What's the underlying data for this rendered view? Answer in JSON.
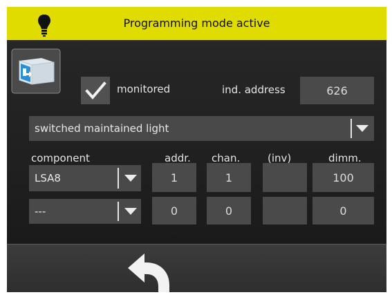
{
  "header": {
    "title": "Programming mode active",
    "bg_color": "#e1dc00",
    "icon": "light-bulb-icon"
  },
  "device": {
    "icon": "emergency-exit-sign-icon"
  },
  "monitored": {
    "checked": true,
    "label": "monitored"
  },
  "ind_address": {
    "label": "ind. address",
    "value": "626"
  },
  "mode_select": {
    "value": "switched maintained light"
  },
  "columns": {
    "component": "component",
    "addr": "addr.",
    "chan": "chan.",
    "inv": "(inv)",
    "dimm": "dimm."
  },
  "rows": [
    {
      "component": "LSA8",
      "addr": "1",
      "chan": "1",
      "inv": "",
      "dimm": "100"
    },
    {
      "component": "---",
      "addr": "0",
      "chan": "0",
      "inv": "",
      "dimm": "0"
    }
  ],
  "footer": {
    "back_icon": "back-arrow-icon"
  }
}
